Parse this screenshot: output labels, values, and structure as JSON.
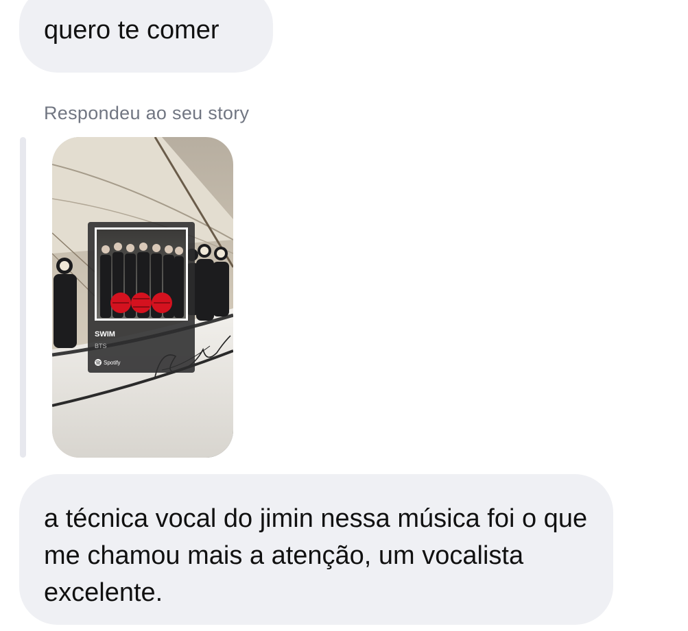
{
  "messages": {
    "top": {
      "text": "quero te comer"
    },
    "reply_label": "Respondeu ao seu story",
    "bottom": {
      "text": "a técnica vocal do jimin nessa música foi o que me chamou mais a atenção, um vocalista excelente."
    }
  },
  "story": {
    "music_sticker": {
      "song_title": "SWIM",
      "artist": "BTS",
      "service": "Spotify"
    }
  },
  "colors": {
    "bubble": "#eff0f4",
    "label": "#717682",
    "reply_bar": "#e7e8ee"
  }
}
